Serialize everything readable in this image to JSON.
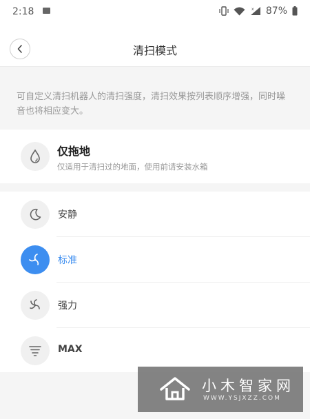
{
  "status": {
    "time": "2:18",
    "battery": "87%"
  },
  "appbar": {
    "title": "清扫模式",
    "back_icon": "chevron-left-icon"
  },
  "description": "可自定义清扫机器人的清扫强度，清扫效果按列表顺序增强，同时噪音也将相应变大。",
  "mop_only": {
    "title": "仅拖地",
    "subtitle": "仅适用于清扫过的地面，使用前请安装水箱",
    "icon": "water-drop-icon"
  },
  "modes": [
    {
      "label": "安静",
      "icon": "moon-icon",
      "selected": false
    },
    {
      "label": "标准",
      "icon": "fan-icon",
      "selected": true
    },
    {
      "label": "强力",
      "icon": "fan-icon",
      "selected": false
    },
    {
      "label": "MAX",
      "icon": "tornado-icon",
      "selected": false
    }
  ],
  "colors": {
    "accent": "#3d8ef0",
    "page_bg": "#f5f5f5"
  },
  "watermark": {
    "title": "小木智家网",
    "url": "WWW.YSJXZZ.COM"
  }
}
